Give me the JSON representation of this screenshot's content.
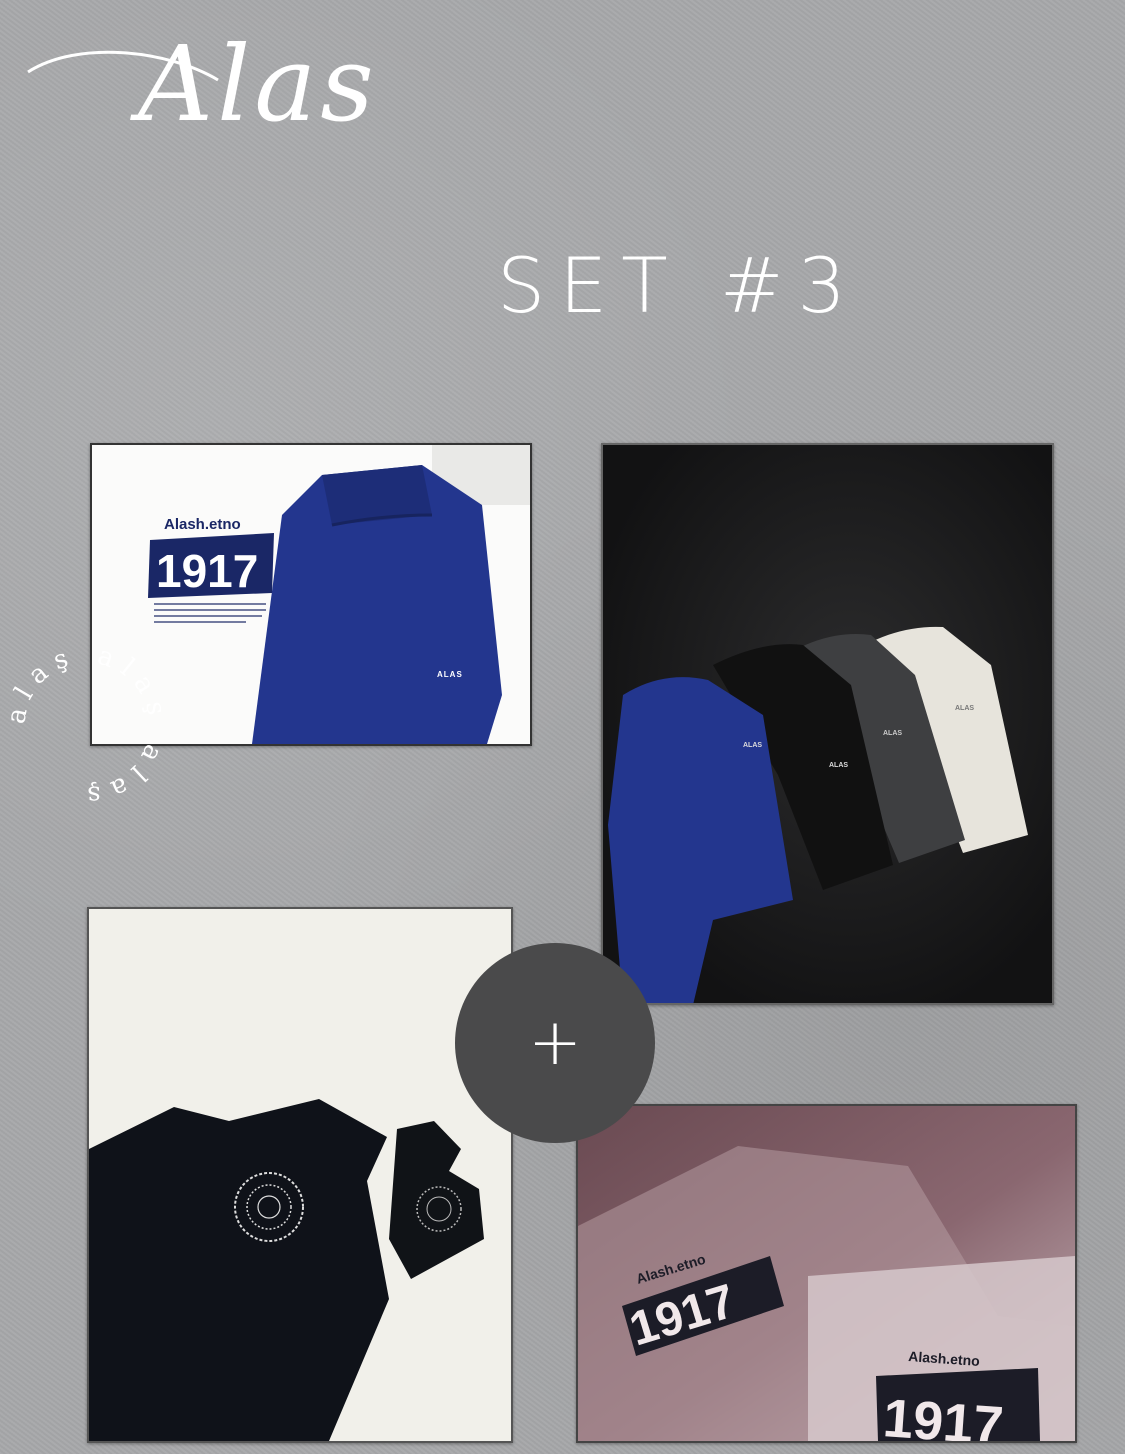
{
  "brand": {
    "logo_text": "Alas"
  },
  "set_title": "SET #3",
  "seal": {
    "circular_text": "alaş alaş alaş"
  },
  "plus_button": {
    "label": "+"
  },
  "photos": {
    "top_left": {
      "shirt_brand": "Alash.etno",
      "shirt_year": "1917",
      "shorts_label": "ALAS"
    },
    "top_right": {
      "shorts_label_1": "ALAS",
      "shorts_label_2": "ALAS",
      "shorts_label_3": "ALAS",
      "shorts_label_4": "ALAS"
    },
    "bottom_right": {
      "shirt_brand_1": "Alash.etno",
      "shirt_year_1": "1917",
      "shirt_brand_2": "Alash.etno",
      "shirt_year_2": "1917"
    }
  },
  "colors": {
    "background": "#a7a8aa",
    "shorts_blue": "#23368e",
    "shorts_black": "#111111",
    "shorts_gray": "#3e3f41",
    "shorts_cream": "#e7e4dc",
    "print_navy": "#1a2766",
    "plus_button": "#4a4a4b"
  }
}
